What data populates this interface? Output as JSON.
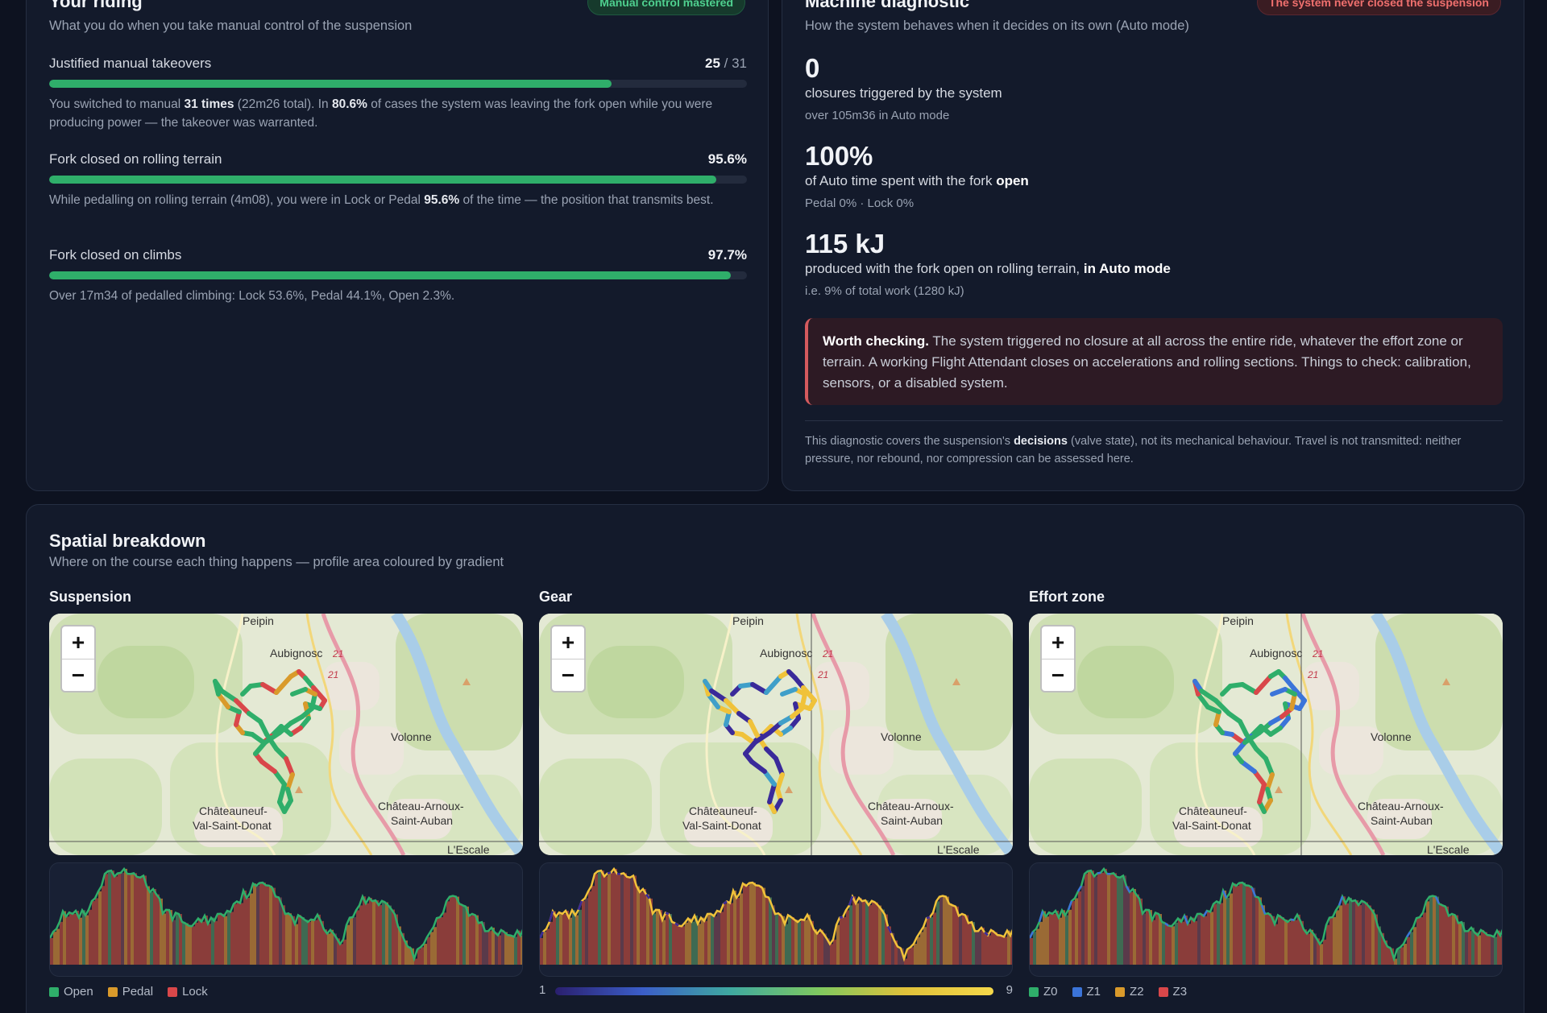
{
  "riding": {
    "title": "Your riding",
    "subtitle": "What you do when you take manual control of the suspension",
    "badge": "Manual control mastered",
    "metrics": [
      {
        "label": "Justified manual takeovers",
        "value": "25",
        "value_total": " / 31",
        "fraction": 0.806,
        "desc_parts": [
          "You switched to manual ",
          "31 times",
          " (22m26 total). In ",
          "80.6%",
          " of cases the system was leaving the fork open while you were producing power — the takeover was warranted."
        ]
      },
      {
        "label": "Fork closed on rolling terrain",
        "value": "95.6%",
        "fraction": 0.956,
        "desc_parts": [
          "While pedalling on rolling terrain (4m08), you were in Lock or Pedal ",
          "95.6%",
          " of the time — the position that transmits best."
        ]
      },
      {
        "label": "Fork closed on climbs",
        "value": "97.7%",
        "fraction": 0.977,
        "desc": "Over 17m34 of pedalled climbing: Lock 53.6%, Pedal 44.1%, Open 2.3%."
      }
    ]
  },
  "machine": {
    "title": "Machine diagnostic",
    "subtitle": "How the system behaves when it decides on its own (Auto mode)",
    "badge": "The system never closed the suspension",
    "stats": [
      {
        "big": "0",
        "text": "closures triggered by the system",
        "small": "over 105m36 in Auto mode"
      },
      {
        "big": "100%",
        "text": "of Auto time spent with the fork ",
        "text_bold": "open",
        "small": "Pedal 0% · Lock 0%"
      },
      {
        "big": "115 kJ",
        "text": "produced with the fork open on rolling terrain, ",
        "text_bold": "in Auto mode",
        "small": "i.e. 9% of total work (1280 kJ)"
      }
    ],
    "warning_bold": "Worth checking.",
    "warning_text": " The system triggered no closure at all across the entire ride, whatever the effort zone or terrain. A working Flight Attendant closes on accelerations and rolling sections. Things to check: calibration, sensors, or a disabled system.",
    "footnote_a": "This diagnostic covers the suspension's ",
    "footnote_bold": "decisions",
    "footnote_b": " (valve state), not its mechanical behaviour. Travel is not transmitted: neither pressure, nor rebound, nor compression can be assessed here."
  },
  "spatial": {
    "title": "Spatial breakdown",
    "subtitle": "Where on the course each thing happens — profile area coloured by gradient",
    "columns": [
      {
        "title": "Suspension"
      },
      {
        "title": "Gear"
      },
      {
        "title": "Effort zone"
      }
    ],
    "map_labels": {
      "peipin": "Peipin",
      "aubignosc": "Aubignosc",
      "road_21a": "21",
      "road_21b": "21",
      "volonne": "Volonne",
      "chateauneuf_1": "Châteauneuf-",
      "chateauneuf_2": "Val-Saint-Donat",
      "chateau_arnoux_1": "Château-Arnoux-",
      "chateau_arnoux_2": "Saint-Auban",
      "escale": "L'Escale"
    },
    "zoom_in": "+",
    "zoom_out": "−",
    "suspension_legend": [
      {
        "label": "Open",
        "color": "#2fae6a"
      },
      {
        "label": "Pedal",
        "color": "#d99a2b"
      },
      {
        "label": "Lock",
        "color": "#d9474a"
      }
    ],
    "gear_legend": {
      "min": "1",
      "max": "9"
    },
    "effort_legend": [
      {
        "label": "Z0",
        "color": "#2fae6a"
      },
      {
        "label": "Z1",
        "color": "#3b74d9"
      },
      {
        "label": "Z2",
        "color": "#d99a2b"
      },
      {
        "label": "Z3",
        "color": "#d9474a"
      }
    ],
    "colors": {
      "open": "#2fae6a",
      "pedal": "#d99a2b",
      "lock": "#d9474a",
      "z1": "#3b74d9",
      "gear_low": "#3a2a9a",
      "gear_mid": "#3f9fc9",
      "gear_high": "#f0c23a"
    }
  }
}
